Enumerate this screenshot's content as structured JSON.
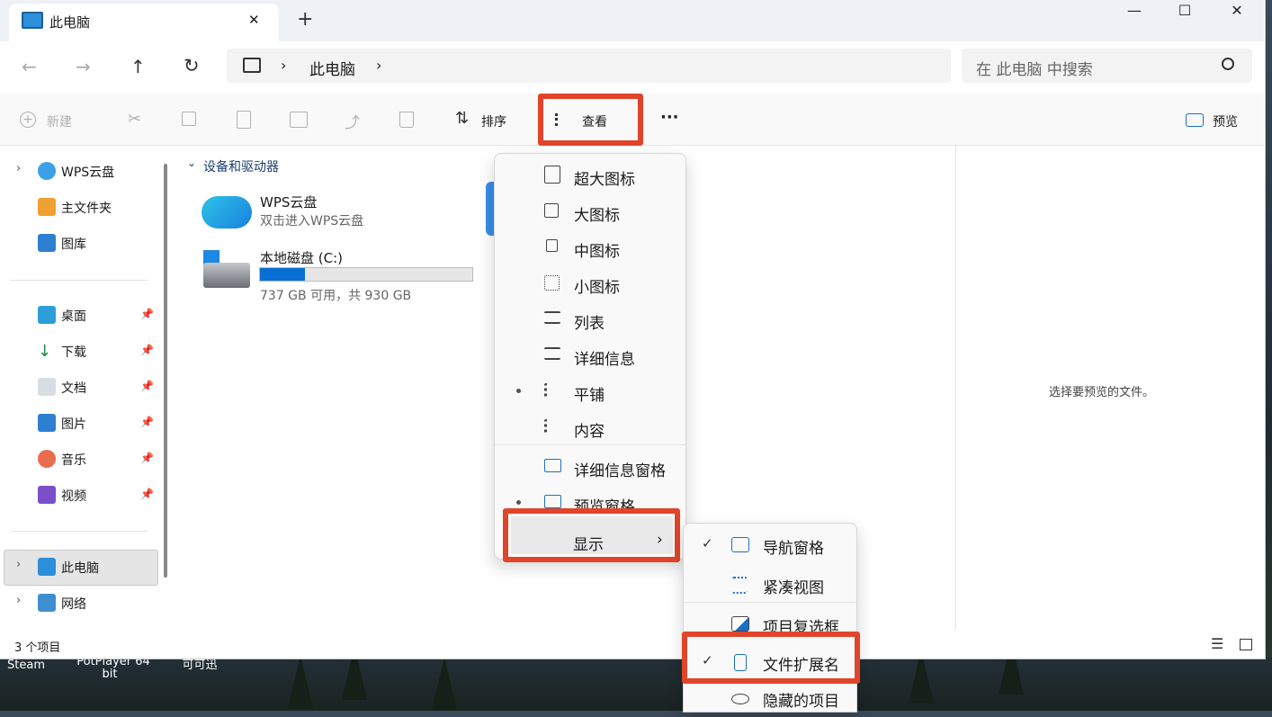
{
  "window": {
    "tab_title": "此电脑",
    "new_tab": "+",
    "close_tab": "✕",
    "minimize": "—",
    "maximize": "☐",
    "close": "✕"
  },
  "nav": {
    "back": "←",
    "forward": "→",
    "up": "↑",
    "refresh": "↻",
    "breadcrumb": [
      "此电脑"
    ],
    "search_placeholder": "在 此电脑 中搜索"
  },
  "toolbar": {
    "new_label": "新建",
    "sort_label": "排序",
    "view_label": "查看",
    "more_label": "···",
    "preview_label": "预览"
  },
  "sidebar": {
    "top_items": [
      {
        "label": "WPS云盘",
        "icon": "cloud-icon"
      },
      {
        "label": "主文件夹",
        "icon": "home-icon"
      },
      {
        "label": "图库",
        "icon": "gallery-icon"
      }
    ],
    "quick_items": [
      {
        "label": "桌面",
        "icon": "desktop-icon"
      },
      {
        "label": "下载",
        "icon": "download-icon"
      },
      {
        "label": "文档",
        "icon": "document-icon"
      },
      {
        "label": "图片",
        "icon": "pictures-icon"
      },
      {
        "label": "音乐",
        "icon": "music-icon"
      },
      {
        "label": "视频",
        "icon": "video-icon"
      }
    ],
    "bottom_items": [
      {
        "label": "此电脑",
        "icon": "computer-icon"
      },
      {
        "label": "网络",
        "icon": "network-icon"
      }
    ]
  },
  "content": {
    "group_header": "设备和驱动器",
    "items": [
      {
        "name": "WPS云盘",
        "sub": "双击进入WPS云盘"
      },
      {
        "name": "本地磁盘 (C:)",
        "sub": "737 GB 可用，共 930 GB",
        "used_fraction": 0.21
      }
    ]
  },
  "preview_text": "选择要预览的文件。",
  "status": {
    "count": "3 个项目"
  },
  "view_menu": {
    "items": [
      "超大图标",
      "大图标",
      "中图标",
      "小图标",
      "列表",
      "详细信息",
      "平铺",
      "内容"
    ],
    "selected_layout": "平铺",
    "panes": [
      "详细信息窗格",
      "预览窗格"
    ],
    "selected_pane": "预览窗格",
    "show_label": "显示",
    "show_arrow": "›"
  },
  "show_menu": {
    "items": [
      {
        "label": "导航窗格",
        "checked": true
      },
      {
        "label": "紧凑视图",
        "checked": false
      },
      {
        "label": "项目复选框",
        "checked": false
      },
      {
        "label": "文件扩展名",
        "checked": true
      },
      {
        "label": "隐藏的项目",
        "checked": false
      }
    ],
    "check_mark": "✓"
  },
  "desktop": {
    "labels": [
      "Steam",
      "PotPlayer 64",
      "bit",
      "可可迅"
    ]
  },
  "colors": {
    "accent": "#0067c0",
    "highlight": "#e0452a",
    "drive_bar": "#0a6fd4"
  }
}
